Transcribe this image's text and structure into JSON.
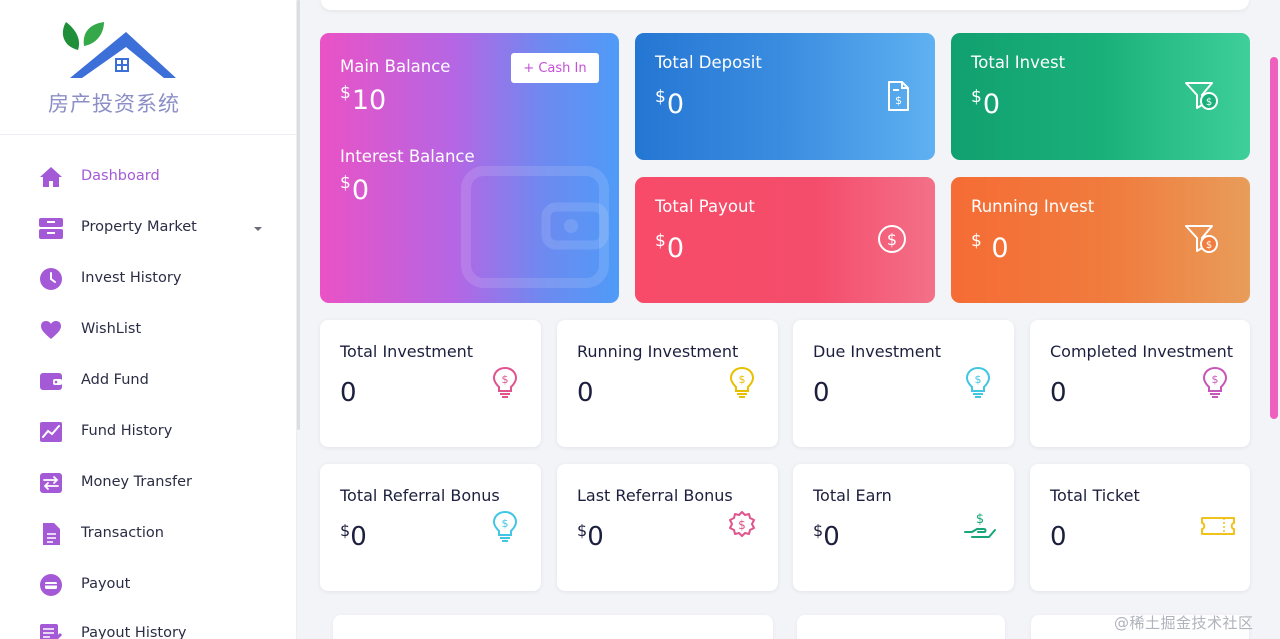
{
  "brand": {
    "name": "房产投资系统",
    "logo_icon": "house-leaf-logo"
  },
  "sidebar": {
    "items": [
      {
        "label": "Dashboard",
        "icon": "home-icon",
        "active": true
      },
      {
        "label": "Property Market",
        "icon": "drawer-icon",
        "has_submenu": true
      },
      {
        "label": "Invest History",
        "icon": "clock-icon"
      },
      {
        "label": "WishList",
        "icon": "heart-icon"
      },
      {
        "label": "Add Fund",
        "icon": "wallet-icon"
      },
      {
        "label": "Fund History",
        "icon": "chart-line-icon"
      },
      {
        "label": "Money Transfer",
        "icon": "transfer-icon"
      },
      {
        "label": "Transaction",
        "icon": "document-icon"
      },
      {
        "label": "Payout",
        "icon": "payout-icon"
      },
      {
        "label": "Payout History",
        "icon": "edit-list-icon"
      }
    ]
  },
  "balance": {
    "main_label": "Main Balance",
    "main_currency": "$",
    "main_value": "10",
    "cash_in_label": "Cash In",
    "interest_label": "Interest Balance",
    "interest_currency": "$",
    "interest_value": "0"
  },
  "gradient_cards": [
    {
      "title": "Total Deposit",
      "currency": "$",
      "value": "0",
      "icon": "invoice-dollar-icon",
      "colors": [
        "#2476d3",
        "#5fb1f1"
      ]
    },
    {
      "title": "Total Invest",
      "currency": "$",
      "value": "0",
      "icon": "filter-dollar-icon",
      "colors": [
        "#11a070",
        "#3ecf9a"
      ]
    },
    {
      "title": "Total Payout",
      "currency": "$",
      "value": "0",
      "icon": "dollar-circle-icon",
      "colors": [
        "#f74b69",
        "#f37088"
      ]
    },
    {
      "title": "Running Invest",
      "currency": "$",
      "value": "0",
      "icon": "filter-dollar-icon",
      "colors": [
        "#f56c35",
        "#e89d5a"
      ]
    }
  ],
  "stat_cards": [
    {
      "title": "Total Investment",
      "currency": "",
      "value": "0",
      "icon": "lightbulb-dollar-icon",
      "icon_color": "#e0548e"
    },
    {
      "title": "Running Investment",
      "currency": "",
      "value": "0",
      "icon": "lightbulb-dollar-icon",
      "icon_color": "#e8c000"
    },
    {
      "title": "Due Investment",
      "currency": "",
      "value": "0",
      "icon": "lightbulb-dollar-icon",
      "icon_color": "#42c6e4"
    },
    {
      "title": "Completed Investment",
      "currency": "",
      "value": "0",
      "icon": "lightbulb-dollar-icon",
      "icon_color": "#c657b8"
    },
    {
      "title": "Total Referral Bonus",
      "currency": "$",
      "value": "0",
      "icon": "lightbulb-dollar-icon",
      "icon_color": "#42c6e4"
    },
    {
      "title": "Last Referral Bonus",
      "currency": "$",
      "value": "0",
      "icon": "badge-dollar-icon",
      "icon_color": "#e0548e"
    },
    {
      "title": "Total Earn",
      "currency": "$",
      "value": "0",
      "icon": "hand-dollar-icon",
      "icon_color": "#17a57a"
    },
    {
      "title": "Total Ticket",
      "currency": "",
      "value": "0",
      "icon": "ticket-icon",
      "icon_color": "#f1c21b"
    }
  ],
  "accent_color": "#a45ad6",
  "watermark": "@稀土掘金技术社区"
}
